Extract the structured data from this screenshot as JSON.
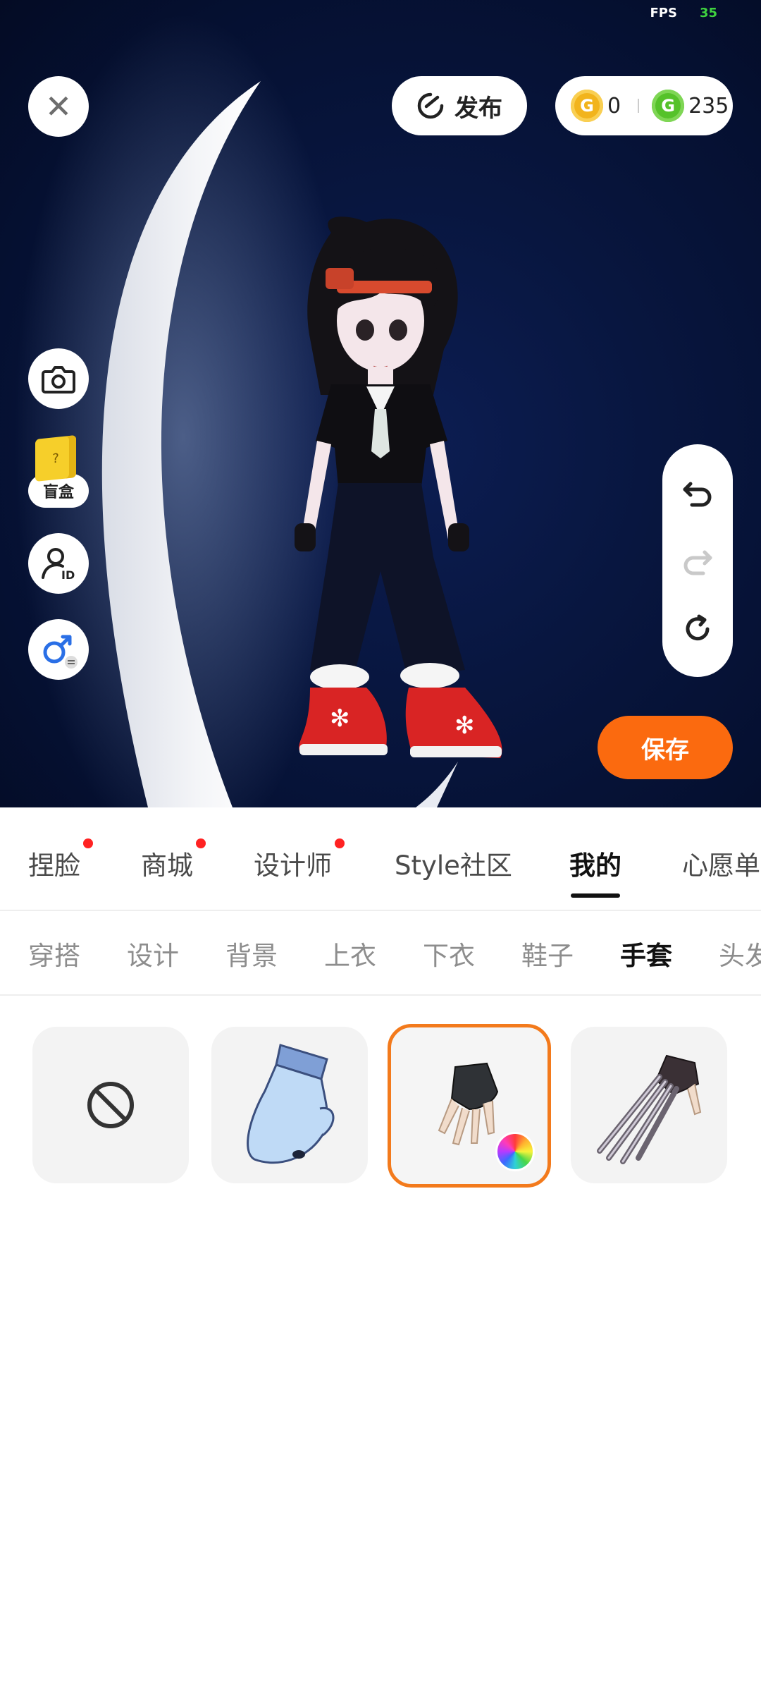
{
  "fps": {
    "label": "FPS",
    "value": "35"
  },
  "header": {
    "publish_label": "发布",
    "gold_coins": "0",
    "green_coins": "235"
  },
  "left_toolbar": {
    "blindbox_label": "盲盒"
  },
  "save_label": "保存",
  "main_tabs": [
    {
      "label": "捏脸",
      "dot": true
    },
    {
      "label": "商城",
      "dot": true
    },
    {
      "label": "设计师",
      "dot": true
    },
    {
      "label": "Style社区",
      "dot": false
    },
    {
      "label": "我的",
      "dot": false,
      "active": true
    },
    {
      "label": "心愿单",
      "dot": false
    }
  ],
  "sub_tabs": [
    {
      "label": "穿搭"
    },
    {
      "label": "设计"
    },
    {
      "label": "背景"
    },
    {
      "label": "上衣"
    },
    {
      "label": "下衣"
    },
    {
      "label": "鞋子"
    },
    {
      "label": "手套",
      "active": true
    },
    {
      "label": "头发"
    }
  ],
  "items": [
    {
      "icon": "none-icon"
    },
    {
      "icon": "blue-mitten-icon"
    },
    {
      "icon": "black-fingerless-glove-icon",
      "selected": true,
      "color_picker": true
    },
    {
      "icon": "claw-glove-icon"
    }
  ],
  "colors": {
    "accent": "#fb6a0f",
    "selected_border": "#f37a1c",
    "notification_dot": "#ff2222",
    "scene_bg": "#08163f"
  }
}
